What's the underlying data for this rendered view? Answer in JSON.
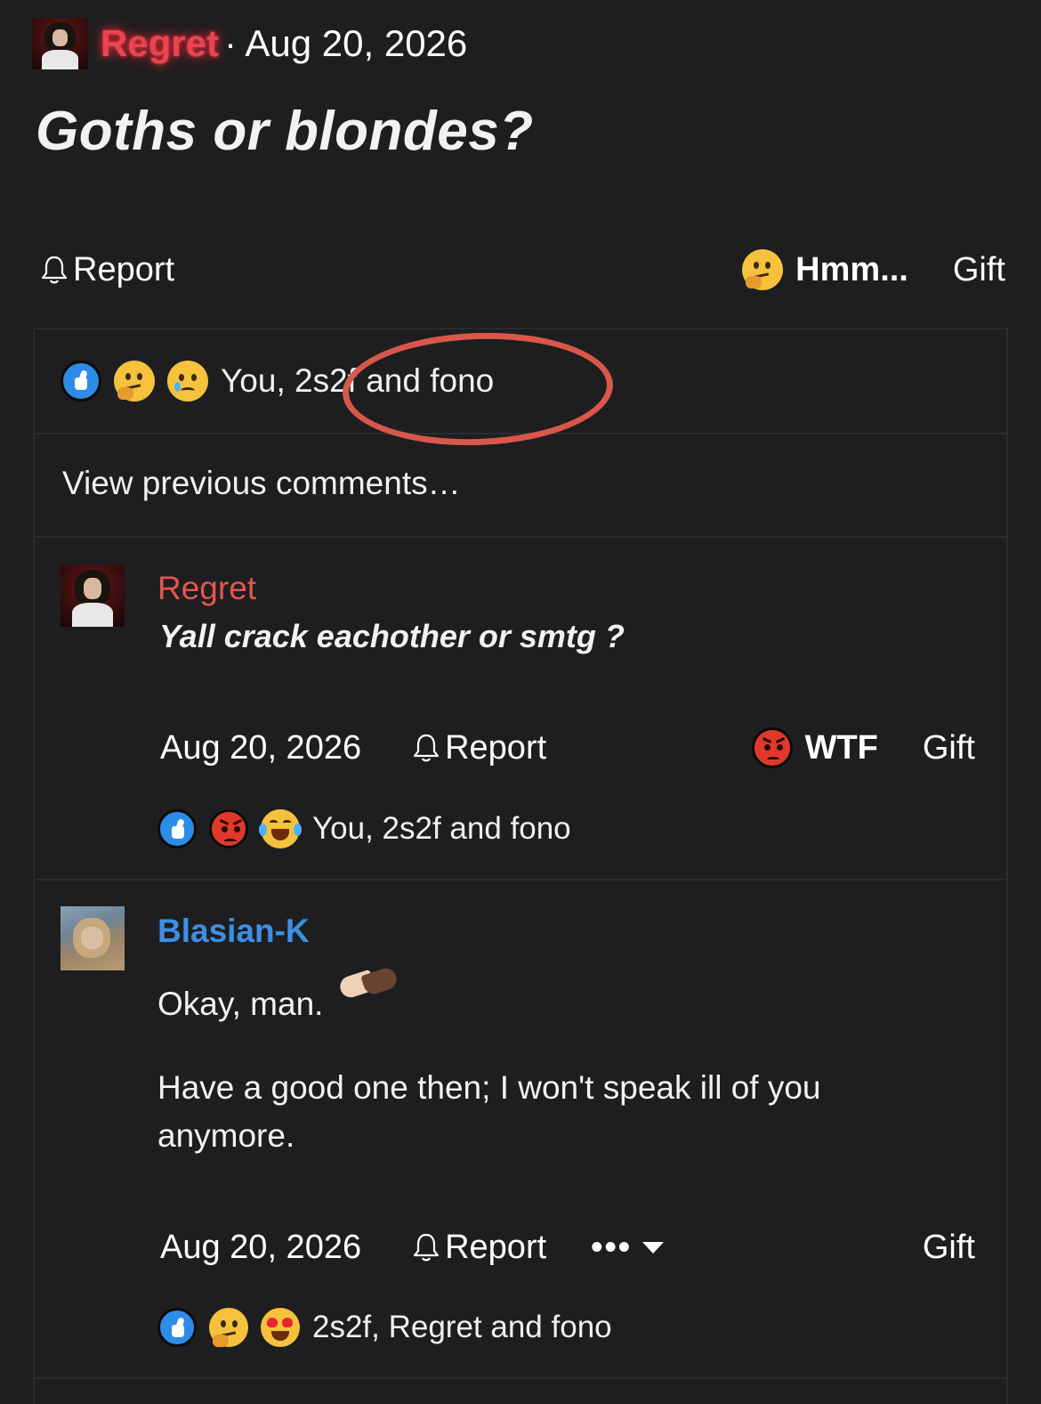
{
  "post": {
    "author": "Regret",
    "date": "· Aug 20, 2026",
    "title": "Goths or blondes?",
    "report_label": "Report",
    "my_reaction": "Hmm...",
    "gift_label": "Gift",
    "reactions": {
      "icons": [
        "like-icon",
        "thinking-face-icon",
        "sad-face-icon"
      ],
      "text": "You, 2s2f and fono"
    },
    "view_previous": "View previous comments…"
  },
  "comments": [
    {
      "author": "Regret",
      "author_color": "#e2574c",
      "text": "Yall crack eachother or smtg ?",
      "date": "Aug 20, 2026",
      "report_label": "Report",
      "my_reaction": "WTF",
      "gift_label": "Gift",
      "reactions": {
        "icons": [
          "like-icon",
          "angry-face-icon",
          "laughing-crying-icon"
        ],
        "text": "You, 2s2f and fono"
      }
    },
    {
      "author": "Blasian-K",
      "author_color": "#3d8fe4",
      "text_line1": "Okay, man.",
      "text_line2": "Have a good one then; I won't speak ill of you",
      "text_line3": "anymore.",
      "date": "Aug 20, 2026",
      "report_label": "Report",
      "more_label": "•••",
      "gift_label": "Gift",
      "reactions": {
        "icons": [
          "like-icon",
          "thinking-face-icon",
          "heart-eyes-icon"
        ],
        "text": "2s2f, Regret and fono"
      }
    }
  ],
  "colors": {
    "background": "#1e1e20",
    "author_glow": "#e84550",
    "annotation_ring": "#d9574a"
  }
}
